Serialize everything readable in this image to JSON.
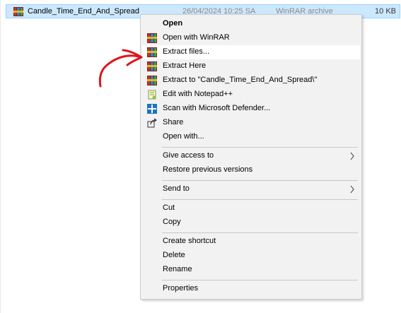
{
  "file": {
    "name": "Candle_Time_End_And_Spread",
    "date": "26/04/2024 10:25 SA",
    "type": "WinRAR archive",
    "size": "10 KB"
  },
  "context_menu": {
    "open": "Open",
    "open_with_winrar": "Open with WinRAR",
    "extract_files": "Extract files...",
    "extract_here": "Extract Here",
    "extract_to": "Extract to \"Candle_Time_End_And_Spread\\\"",
    "edit_notepad": "Edit with Notepad++",
    "scan_defender": "Scan with Microsoft Defender...",
    "share": "Share",
    "open_with": "Open with...",
    "give_access": "Give access to",
    "restore_versions": "Restore previous versions",
    "send_to": "Send to",
    "cut": "Cut",
    "copy": "Copy",
    "create_shortcut": "Create shortcut",
    "delete": "Delete",
    "rename": "Rename",
    "properties": "Properties"
  },
  "colors": {
    "selection_bg": "#cce8ff",
    "menu_bg": "#f2f2f2",
    "hover_bg": "#ffffff",
    "annotation_arrow": "#e0141e"
  },
  "icons": {
    "winrar": "winrar-icon",
    "notepad": "notepad-plus-plus-icon",
    "defender": "microsoft-defender-icon",
    "share": "share-icon",
    "submenu": "chevron-right-icon"
  }
}
